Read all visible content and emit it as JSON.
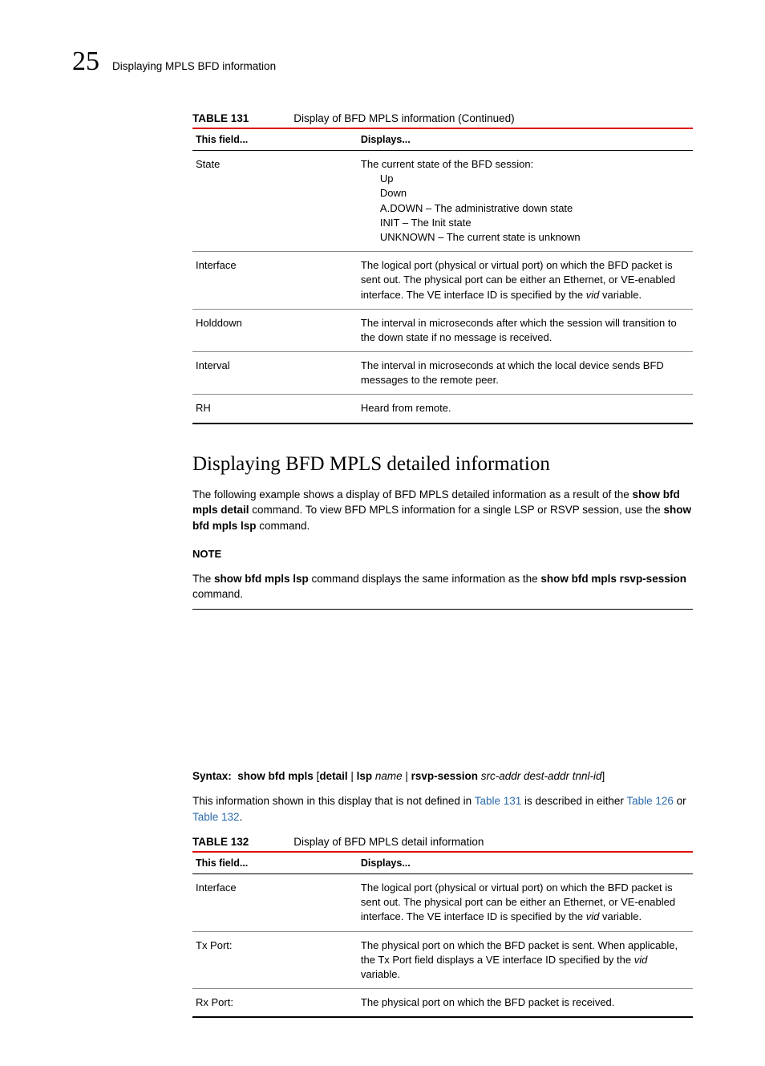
{
  "header": {
    "page_number": "25",
    "page_title_small": "Displaying MPLS BFD information"
  },
  "table1": {
    "label": "TABLE 131",
    "caption": "Display of BFD MPLS information  (Continued)",
    "head_field": "This field...",
    "head_displays": "Displays...",
    "rows": [
      {
        "field": "State",
        "lines": [
          "The current state of the BFD session:",
          "Up",
          "Down",
          "A.DOWN – The administrative down state",
          "INIT – The Init state",
          "UNKNOWN – The current state is unknown"
        ]
      },
      {
        "field": "Interface",
        "lines": [
          "The logical port (physical or virtual port) on which the BFD packet is sent out. The physical port can be either an Ethernet, or VE-enabled interface. The VE interface ID is specified by the vid variable."
        ]
      },
      {
        "field": "Holddown",
        "lines": [
          "The interval in microseconds after which the session will transition to the down state if no message is received."
        ]
      },
      {
        "field": "Interval",
        "lines": [
          "The interval in microseconds at which the local device sends BFD messages to the remote peer."
        ]
      },
      {
        "field": "RH",
        "lines": [
          "Heard from remote."
        ]
      }
    ]
  },
  "section": {
    "heading": "Displaying BFD MPLS detailed information",
    "para1_prefix": "The following example shows a display of BFD MPLS detailed information as a result of the ",
    "para1_cmd1": "show bfd mpls detail",
    "para1_mid": " command. To view BFD MPLS information for a single LSP or RSVP session, use the ",
    "para1_cmd2": "show bfd mpls lsp",
    "para1_suffix": " command.",
    "note_label": "NOTE",
    "note_prefix": "The ",
    "note_cmd1": "show bfd mpls lsp",
    "note_mid": " command displays the same information as the ",
    "note_cmd2": "show bfd mpls rsvp-session",
    "note_suffix": " command.",
    "syntax_label": "Syntax:",
    "syntax_cmd": "show bfd mpls",
    "syntax_bracket_open": " [",
    "syntax_detail": "detail",
    "syntax_pipe1": " | ",
    "syntax_lsp": "lsp",
    "syntax_name": " name",
    "syntax_pipe2": " | ",
    "syntax_rsvp": "rsvp-session",
    "syntax_args": " src-addr dest-addr tnnl-id",
    "syntax_bracket_close": "]",
    "para2_prefix": "This information shown in this display that is not defined in ",
    "para2_link1": "Table 131",
    "para2_mid": " is described in either ",
    "para2_link2": "Table 126",
    "para2_or": " or ",
    "para2_link3": "Table 132",
    "para2_suffix": "."
  },
  "table2": {
    "label": "TABLE 132",
    "caption": "Display of BFD MPLS detail information",
    "head_field": "This field...",
    "head_displays": "Displays...",
    "rows": [
      {
        "field": "Interface",
        "text": "The logical port (physical or virtual port) on which the BFD packet is sent out. The physical port can be either an Ethernet, or VE-enabled interface. The VE interface ID is specified by the vid variable."
      },
      {
        "field": "Tx Port:",
        "text": "The physical port on which the BFD packet is sent. When applicable, the Tx Port field displays a VE interface ID specified by the vid variable."
      },
      {
        "field": "Rx Port:",
        "text": "The physical port on which the BFD packet is received."
      }
    ]
  }
}
